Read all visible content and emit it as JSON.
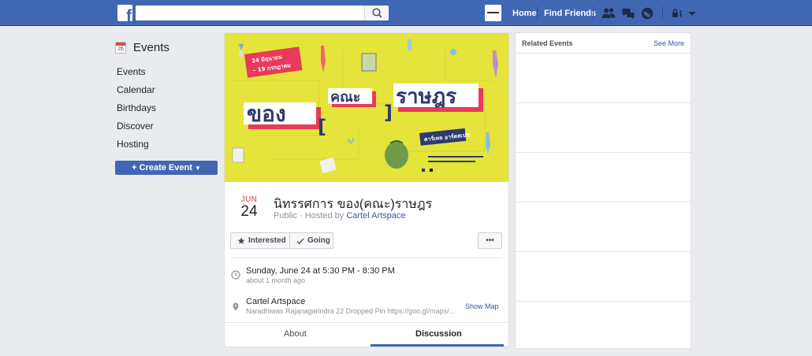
{
  "topbar": {
    "logo": "f",
    "search_placeholder": "",
    "nav": {
      "home": "Home",
      "find_friends": "Find Friends"
    },
    "icons": [
      "friend-requests-icon",
      "messages-icon",
      "notifications-icon",
      "quick-help-icon",
      "account-menu-icon"
    ]
  },
  "sidebar": {
    "title": "Events",
    "calendar_icon_day": "26",
    "items": [
      "Events",
      "Calendar",
      "Birthdays",
      "Discover",
      "Hosting"
    ],
    "create_label": "Create Event"
  },
  "event": {
    "cover_art_title": "ของ[คณะ]ราษฎร",
    "cover_art_dates": [
      "24 มิถุนายน",
      "– 19 กรกฎาคม"
    ],
    "cover_art_venue": "คาร์เทล อาร์ตสเปซ",
    "month": "JUN",
    "day": "24",
    "title": "นิทรรศการ ของ(คณะ)ราษฎร",
    "privacy": "Public · Hosted by",
    "host": "Cartel Artspace",
    "interested_label": "Interested",
    "going_label": "Going",
    "more_label": "•••",
    "time_main": "Sunday, June 24 at 5:30 PM - 8:30 PM",
    "time_sub": "about 1 month ago",
    "place_main": "Cartel Artspace",
    "place_sub": "Naradhiwas Rajanagarindra 22 Dropped Pin https://goo.gl/maps/...",
    "show_map": "Show Map",
    "tabs": {
      "about": "About",
      "discussion": "Discussion"
    },
    "active_tab": "Discussion"
  },
  "related": {
    "title": "Related Events",
    "see_more": "See More"
  },
  "colors": {
    "brand": "#4267b2",
    "page_bg": "#e9ebee",
    "cover_yellow": "#e4e43a",
    "date_red": "#e0393e",
    "link": "#365899"
  }
}
